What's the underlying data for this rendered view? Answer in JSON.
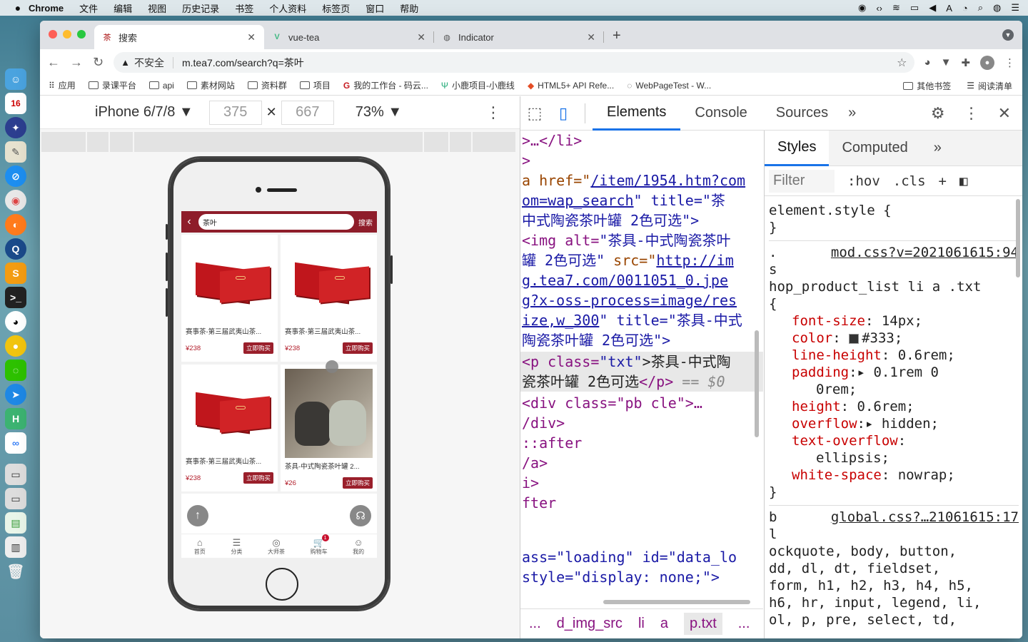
{
  "menubar": {
    "app": "Chrome",
    "items": [
      "文件",
      "编辑",
      "视图",
      "历史记录",
      "书签",
      "个人资料",
      "标签页",
      "窗口",
      "帮助"
    ]
  },
  "tabs": [
    {
      "label": "搜索"
    },
    {
      "label": "vue-tea"
    },
    {
      "label": "Indicator"
    }
  ],
  "address": {
    "security": "不安全",
    "url": "m.tea7.com/search?q=茶叶"
  },
  "bookmarks": {
    "items": [
      "应用",
      "录课平台",
      "api",
      "素材网站",
      "资料群",
      "项目",
      "我的工作台 - 码云...",
      "小鹿项目-小鹿线",
      "HTML5+ API Refe...",
      "WebPageTest - W..."
    ],
    "right": [
      "其他书签",
      "阅读清单"
    ]
  },
  "device": {
    "name": "iPhone 6/7/8 ▼",
    "width": "375",
    "height": "667",
    "times": "✕",
    "zoom": "73% ▼"
  },
  "mobile": {
    "search_value": "茶叶",
    "search_btn": "搜索",
    "products": [
      {
        "title": "赛事茶-第三届武夷山茶...",
        "price": "¥238",
        "buy": "立即购买"
      },
      {
        "title": "赛事茶-第三届武夷山茶...",
        "price": "¥238",
        "buy": "立即购买"
      },
      {
        "title": "赛事茶-第三届武夷山茶...",
        "price": "¥238",
        "buy": "立即购买"
      },
      {
        "title": "茶具-中式陶瓷茶叶罐 2...",
        "price": "¥26",
        "buy": "立即购买"
      }
    ],
    "nav": [
      {
        "label": "首页",
        "icon": "⌂"
      },
      {
        "label": "分类",
        "icon": "☰"
      },
      {
        "label": "大师茶",
        "icon": "◎"
      },
      {
        "label": "购物车",
        "icon": "🛒",
        "badge": "1"
      },
      {
        "label": "我的",
        "icon": "☺"
      }
    ]
  },
  "devtools": {
    "tabs": [
      "Elements",
      "Console",
      "Sources",
      "»"
    ],
    "styles_tabs": [
      "Styles",
      "Computed",
      "»"
    ],
    "filter_placeholder": "Filter",
    "hov": ":hov",
    "cls": ".cls",
    "plus": "+",
    "breadcrumbs": [
      "...",
      "d_img_src",
      "li",
      "a",
      "p.txt",
      "..."
    ],
    "elements": {
      "l1": ">…</li>",
      "l2": ">",
      "l3_attr": "a href=\"",
      "l3_link": "/item/1954.htm?com",
      "l4_link": "om=wap_search",
      "l4_rest": "\" title=\"茶",
      "l5": "中式陶瓷茶叶罐 2色可选\">",
      "l6_tag": "<img alt=",
      "l6_val": "\"茶具-中式陶瓷茶叶",
      "l7_val": "罐 2色可选\"",
      "l7_attr": " src=\"",
      "l7_link": "http://im",
      "l8_link": "g.tea7.com/0011051_0.jpe",
      "l9_link": "g?x-oss-process=image/res",
      "l10_link": "ize,w_300",
      "l10_rest": "\" title=\"茶具-中式",
      "l11": "陶瓷茶叶罐 2色可选\">",
      "l12_tag": "<p class=",
      "l12_val": "\"txt\"",
      "l12_text": ">茶具-中式陶",
      "l13_text": "瓷茶叶罐 2色可选",
      "l13_tag": "</p>",
      "l13_eq": " == $0",
      "l14": "<div class=\"pb cle\">…",
      "l15": "/div>",
      "l16": "::after",
      "l17": "/a>",
      "l18": "i>",
      "l19": "fter",
      "l20": "ass=\"loading\" id=\"data_lo",
      "l21": "style=\"display: none;\">"
    },
    "styles": {
      "r0_sel": "element.style {",
      "r0_end": "}",
      "r1_dot": ".",
      "r1_src": "mod.css?v=2021061615:94",
      "r1_sel1": "s",
      "r1_sel2": "hop_product_list li a .txt",
      "r1_open": "{",
      "p1": "font-size",
      "v1": "14px;",
      "p2": "color",
      "v2": "#333;",
      "p3": "line-height",
      "v3": "0.6rem;",
      "p4": "padding",
      "v4": "0.1rem 0",
      "v4b": "0rem;",
      "p5": "height",
      "v5": "0.6rem;",
      "p6": "overflow",
      "v6": "hidden;",
      "p7": "text-overflow",
      "v7": "ellipsis;",
      "p8": "white-space",
      "v8": "nowrap;",
      "r1_end": "}",
      "r2_b": "b",
      "r2_src": "global.css?…21061615:17",
      "r2_l": "l",
      "r2_s1": "ockquote, body, button,",
      "r2_s2": "dd, dl, dt, fieldset,",
      "r2_s3": "form, h1, h2, h3, h4, h5,",
      "r2_s4": "h6, hr, input, legend, li,",
      "r2_s5": "ol, p, pre, select, td,"
    }
  },
  "colors": {
    "brand": "#8e1d2a",
    "devtools_accent": "#1a73e8"
  }
}
